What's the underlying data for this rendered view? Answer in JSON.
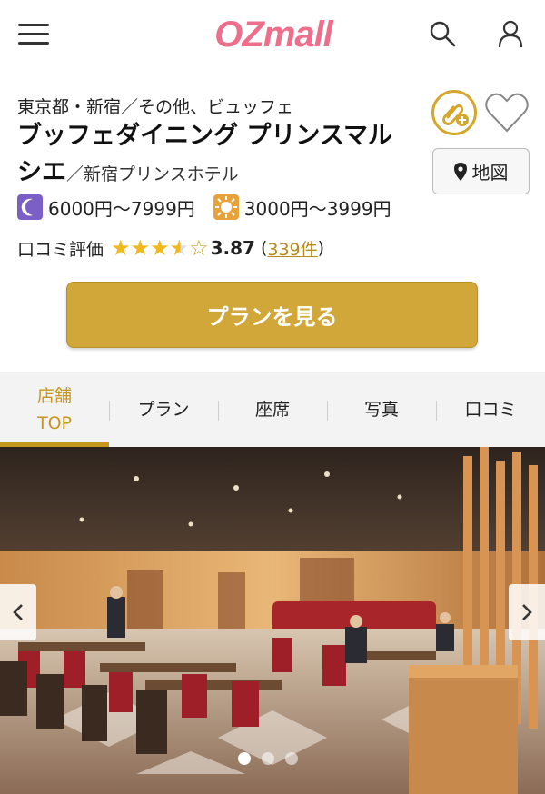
{
  "header": {
    "logo": "OZmall",
    "menu_icon": "hamburger-menu-icon",
    "search_icon": "search-icon",
    "user_icon": "user-icon"
  },
  "shop": {
    "area": "東京都・新宿／その他、ビュッフェ",
    "name": "ブッフェダイニング プリンスマルシエ",
    "hotel": "／新宿プリンスホテル",
    "map_label": "地図",
    "dinner_price": "6000円～7999円",
    "lunch_price": "3000円～3999円",
    "review_label": "口コミ評価",
    "stars": "★★★★☆",
    "rating": 3.87,
    "rating_text": "3.87",
    "review_count_open": "(",
    "review_count": "339件",
    "review_count_close": ")"
  },
  "cta": {
    "label": "プランを見る"
  },
  "tabs": [
    {
      "label_line1": "店舗",
      "label_line2": "TOP",
      "active": true
    },
    {
      "label": "プラン"
    },
    {
      "label": "座席"
    },
    {
      "label": "写真"
    },
    {
      "label": "口コミ"
    }
  ],
  "hero": {
    "slides": 3,
    "active_slide": 1
  },
  "colors": {
    "brand_pink": "#ee6e8b",
    "gold": "#d0a738",
    "tab_active": "#c7961c",
    "star": "#f1b81b",
    "moon_bg": "#7b5fc6",
    "sun_bg": "#e8a23a"
  }
}
